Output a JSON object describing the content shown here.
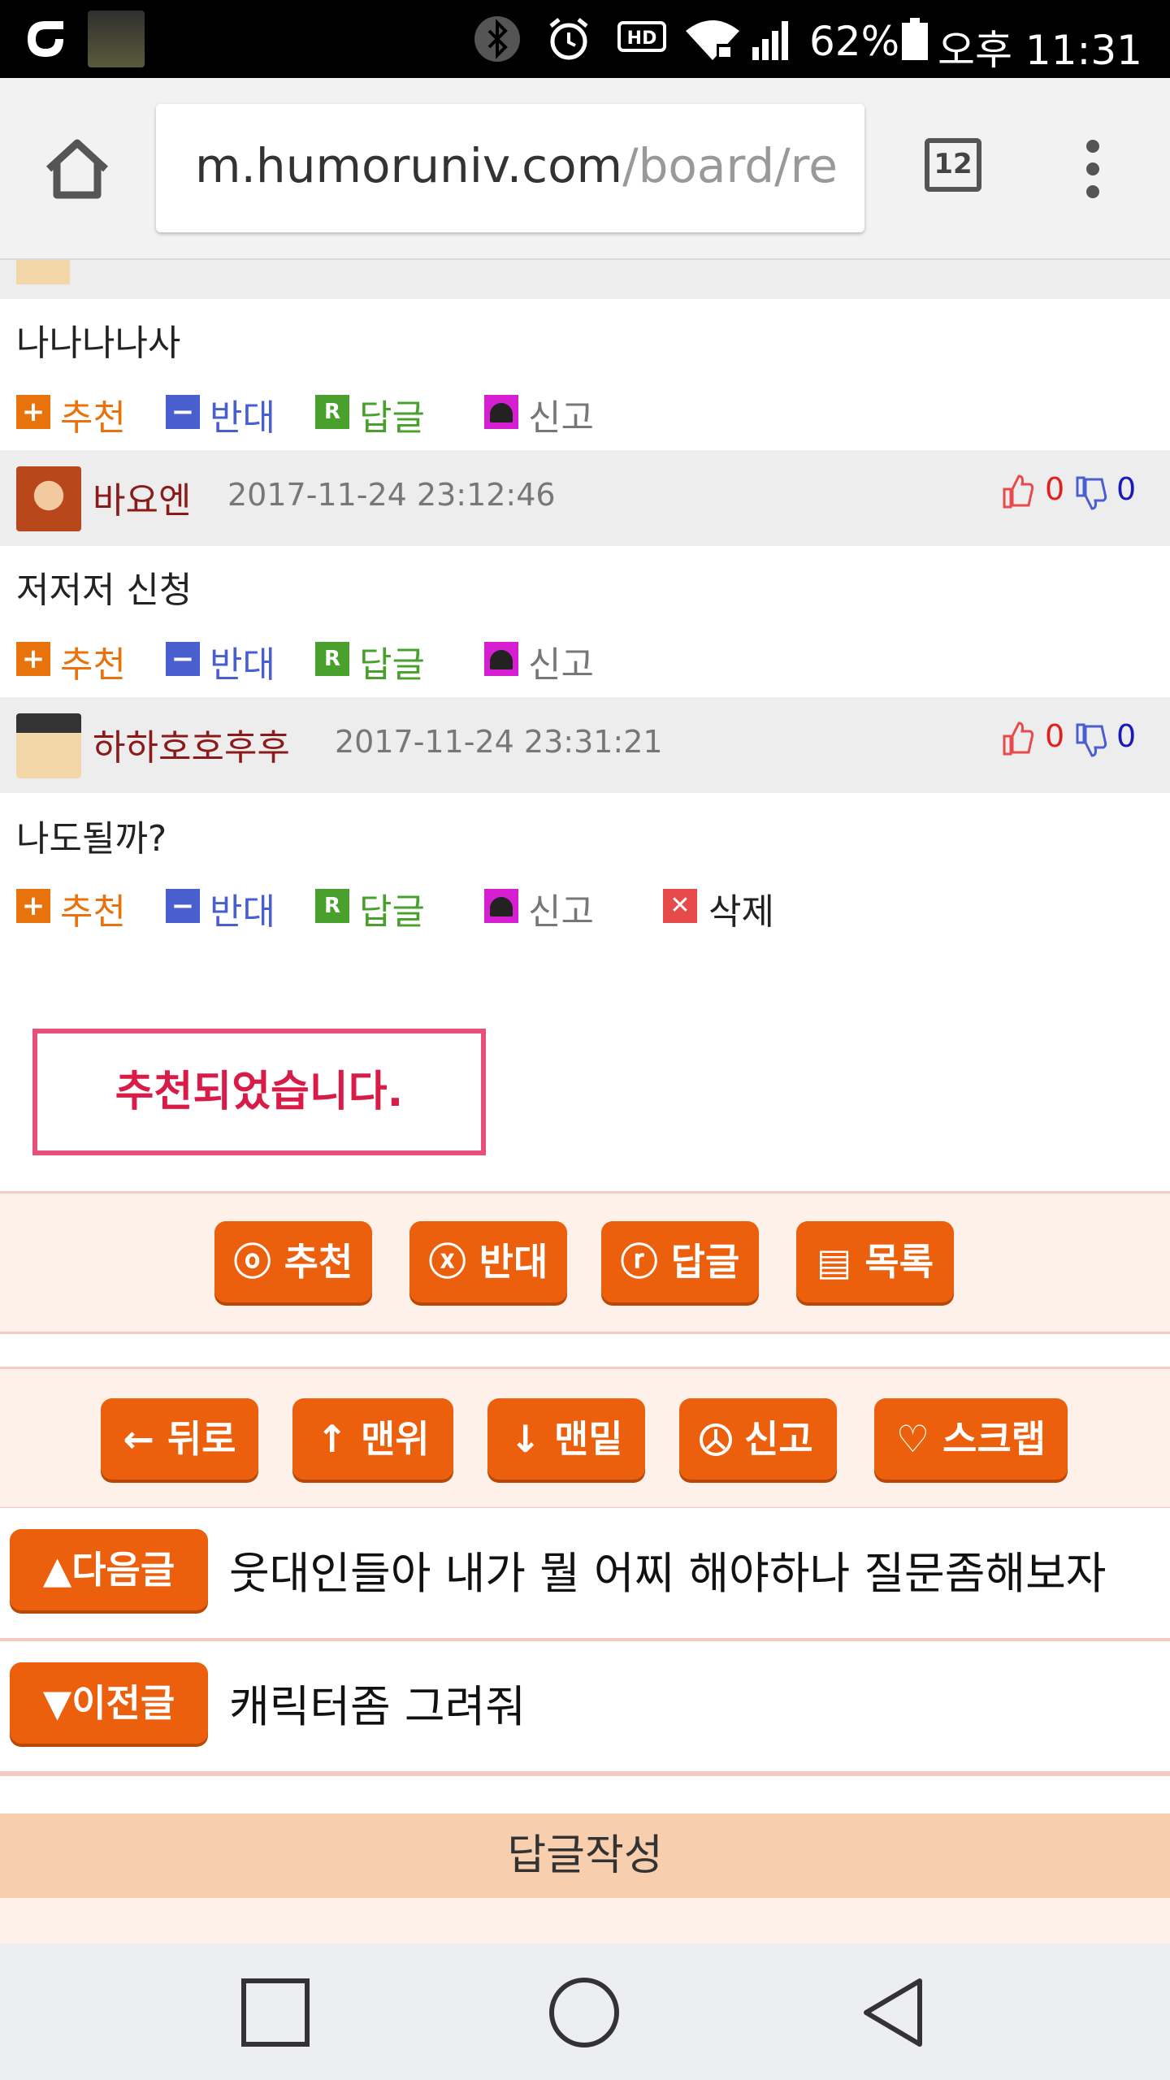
{
  "status_bar": {
    "battery": "62%",
    "time": "오후 11:31",
    "left_icons": [
      "opera-icon",
      "fifa-online-icon"
    ],
    "right_icons": [
      "bluetooth-icon",
      "alarm-icon",
      "hd-icon",
      "wifi-icon",
      "signal-icon",
      "battery-icon"
    ]
  },
  "browser": {
    "url_domain": "m.humoruniv.com",
    "url_path": "/board/re",
    "tab_count": "12"
  },
  "comments": [
    {
      "partial_top": true,
      "body": "나나나나사",
      "actions": [
        "추천",
        "반대",
        "답글",
        "신고"
      ]
    },
    {
      "author": "바요엔",
      "date": "2017-11-24 23:12:46",
      "likes": "0",
      "dislikes": "0",
      "body": "저저저 신청",
      "actions": [
        "추천",
        "반대",
        "답글",
        "신고"
      ]
    },
    {
      "author": "하하호호후후",
      "date": "2017-11-24 23:31:21",
      "likes": "0",
      "dislikes": "0",
      "body": "나도될까?",
      "actions": [
        "추천",
        "반대",
        "답글",
        "신고"
      ],
      "delete_label": "삭제"
    }
  ],
  "notice": "추천되었습니다.",
  "article_buttons": {
    "recommend": "ⓞ 추천",
    "oppose": "ⓧ 반대",
    "reply": "ⓡ 답글",
    "list": "▤ 목록"
  },
  "page_buttons": {
    "back": "← 뒤로",
    "top": "↑ 맨위",
    "bottom": "↓ 맨밑",
    "report": "신고",
    "scrap": "♡ 스크랩"
  },
  "next_post": {
    "label": "▲다음글",
    "title": "웃대인들아 내가 뭘 어찌 해야하나 질문좀해보자"
  },
  "prev_post": {
    "label": "▼이전글",
    "title": "캐릭터좀 그려줘"
  },
  "reply_write": "답글작성",
  "colors": {
    "accent_orange": "#ec5f0c",
    "notice_pink": "#e6507a",
    "recommend": "#e8730c",
    "oppose": "#4a5fcf",
    "reply": "#4aa02c",
    "report": "#d41ed0",
    "delete": "#e64a4a",
    "name": "#8b1a1a"
  }
}
